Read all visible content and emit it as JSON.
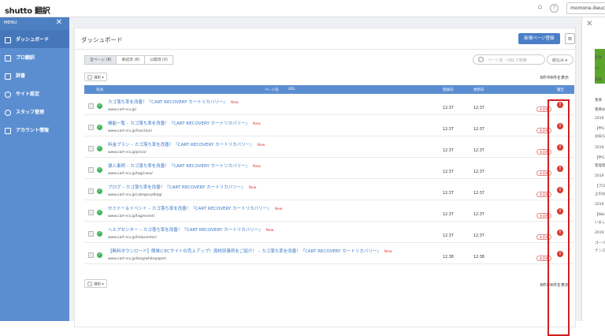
{
  "app": {
    "logo": "shutto 翻訳",
    "user": "momone.ikeuchi",
    "help_icon": "?"
  },
  "sidebar": {
    "menu_label": "MENU",
    "close": "✕",
    "items": [
      {
        "label": "ダッシュボード",
        "icon": "home-icon"
      },
      {
        "label": "プロ翻訳",
        "icon": "translate-icon"
      },
      {
        "label": "辞書",
        "icon": "book-icon"
      },
      {
        "label": "サイト設定",
        "icon": "gear-icon"
      },
      {
        "label": "スタッフ管理",
        "icon": "people-icon"
      },
      {
        "label": "アカウント情報",
        "icon": "document-icon"
      }
    ]
  },
  "main": {
    "title": "ダッシュボード",
    "new_page_button": "新規ページ登録",
    "menu_button": "≡",
    "tabs": [
      "全ページ (8)",
      "承認済 (8)",
      "公開済 (0)"
    ],
    "search_placeholder": "ページ名・URLで検索",
    "filter_label": "絞込み",
    "select_label": "選択",
    "count_text": "8件中8件を表示",
    "headers": {
      "status": "有効",
      "page_name": "ページ名",
      "url": "URL",
      "registered": "登録日",
      "updated": "更新日",
      "alert": "警告"
    },
    "unreflected_label": "未反映",
    "new_label": "New",
    "rows": [
      {
        "title": "カゴ落ち率を改善！『CART RECOVERY カートリカバリー』",
        "url": "www.cart-rcv.jp/",
        "registered": "12:37",
        "updated": "12:37"
      },
      {
        "title": "機能一覧 – カゴ落ち率を改善！『CART RECOVERY カートリカバリー』",
        "url": "www.cart-rcv.jp/function/",
        "registered": "12:37",
        "updated": "12:37"
      },
      {
        "title": "料金プラン – カゴ落ち率を改善！『CART RECOVERY カートリカバリー』",
        "url": "www.cart-rcv.jp/price/",
        "registered": "12:37",
        "updated": "12:37"
      },
      {
        "title": "導入事例 – カゴ落ち率を改善！『CART RECOVERY カートリカバリー』",
        "url": "www.cart-rcv.jp/tag/case/",
        "registered": "12:37",
        "updated": "12:37"
      },
      {
        "title": "ブログ – カゴ落ち率を改善！『CART RECOVERY カートリカバリー』",
        "url": "www.cart-rcv.jp/category/blog/",
        "registered": "12:37",
        "updated": "12:37"
      },
      {
        "title": "セミナー＆イベント – カゴ落ち率を改善！『CART RECOVERY カートリカバリー』",
        "url": "www.cart-rcv.jp/tag/event/",
        "registered": "12:37",
        "updated": "12:37"
      },
      {
        "title": "ヘルプセンター – カゴ落ち率を改善！『CART RECOVERY カートリカバリー』",
        "url": "www.cart-rcv.jp/helpcenter/",
        "registered": "12:37",
        "updated": "12:37"
      },
      {
        "title": "【無料ダウンロード】簡単にECサイトの売上アップ！資材別事例をご紹介！ – カゴ落ち率を改善！『CART RECOVERY カートリカバリー』",
        "url": "www.cart-rcv.jp/blog/whitepaper/",
        "registered": "12:38",
        "updated": "12:38"
      }
    ]
  },
  "right_panel": {
    "close": "✕",
    "lines": [
      "変換",
      "ペー",
      "辞書",
      "重要",
      "重要お",
      "2019",
      "【半S",
      "お知ら",
      "2019",
      "【半S",
      "管理者",
      "2019",
      "【プロ",
      "止のお",
      "2019",
      "【Wai",
      "いまし",
      "2019",
      "ゴーバ",
      "ナンス"
    ]
  },
  "colors": {
    "sidebar": "#5b8ed1",
    "accent": "#4a7fc8",
    "alert": "#d9382f",
    "ok": "#41b45a",
    "highlight": "#d11e1e"
  }
}
